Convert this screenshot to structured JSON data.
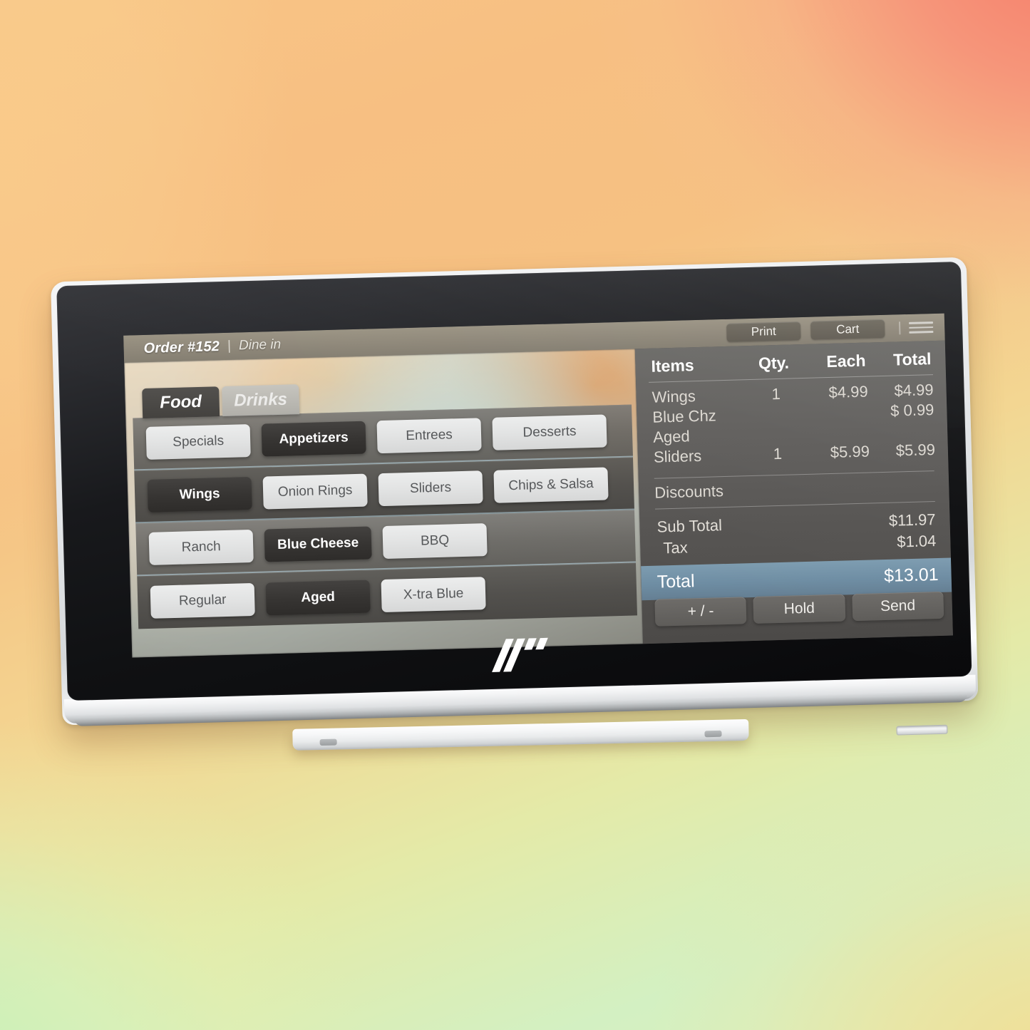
{
  "device": {
    "brand": "hp",
    "logo_name": "hp-logo"
  },
  "header": {
    "order_id": "Order #152",
    "separator": "|",
    "order_mode": "Dine in",
    "print_label": "Print",
    "cart_label": "Cart",
    "menu_icon": "hamburger-menu-icon"
  },
  "tabs": [
    {
      "label": "Food",
      "active": true
    },
    {
      "label": "Drinks",
      "active": false
    }
  ],
  "menu_rows": [
    {
      "name": "category-row",
      "buttons": [
        {
          "label": "Specials",
          "selected": false
        },
        {
          "label": "Appetizers",
          "selected": true
        },
        {
          "label": "Entrees",
          "selected": false
        },
        {
          "label": "Desserts",
          "selected": false
        }
      ]
    },
    {
      "name": "item-row",
      "buttons": [
        {
          "label": "Wings",
          "selected": true
        },
        {
          "label": "Onion Rings",
          "selected": false
        },
        {
          "label": "Sliders",
          "selected": false
        },
        {
          "label": "Chips & Salsa",
          "selected": false
        }
      ]
    },
    {
      "name": "sauce-row",
      "buttons": [
        {
          "label": "Ranch",
          "selected": false
        },
        {
          "label": "Blue Cheese",
          "selected": true
        },
        {
          "label": "BBQ",
          "selected": false
        }
      ]
    },
    {
      "name": "modifier-row",
      "buttons": [
        {
          "label": "Regular",
          "selected": false
        },
        {
          "label": "Aged",
          "selected": true
        },
        {
          "label": "X-tra Blue",
          "selected": false
        }
      ]
    }
  ],
  "receipt": {
    "columns": {
      "item": "Items",
      "qty": "Qty.",
      "each": "Each",
      "total": "Total"
    },
    "lines": [
      {
        "item": "Wings",
        "qty": "1",
        "each": "$4.99",
        "total": "$4.99"
      },
      {
        "item": "Blue Chz",
        "qty": "",
        "each": "",
        "total": "$ 0.99"
      },
      {
        "item": "Aged",
        "qty": "",
        "each": "",
        "total": ""
      },
      {
        "item": "Sliders",
        "qty": "1",
        "each": "$5.99",
        "total": "$5.99"
      }
    ],
    "discounts_label": "Discounts",
    "subtotal_label": "Sub Total",
    "subtotal_value": "$11.97",
    "tax_label": "Tax",
    "tax_value": "$1.04",
    "total_label": "Total",
    "total_value": "$13.01",
    "total_highlight_color": "#6e8da3",
    "actions": [
      {
        "label": "+ / -",
        "name": "plus-minus-button"
      },
      {
        "label": "Hold",
        "name": "hold-button"
      },
      {
        "label": "Send",
        "name": "send-button"
      }
    ]
  },
  "colors": {
    "bg_top_left": "#f8c586",
    "bg_top_right": "#f5907f",
    "bg_bottom_left": "#d6f0c0",
    "bg_bottom_right": "#f2dc93",
    "selected_button": "#36343 2",
    "panel_gray": "#5e5c59"
  }
}
